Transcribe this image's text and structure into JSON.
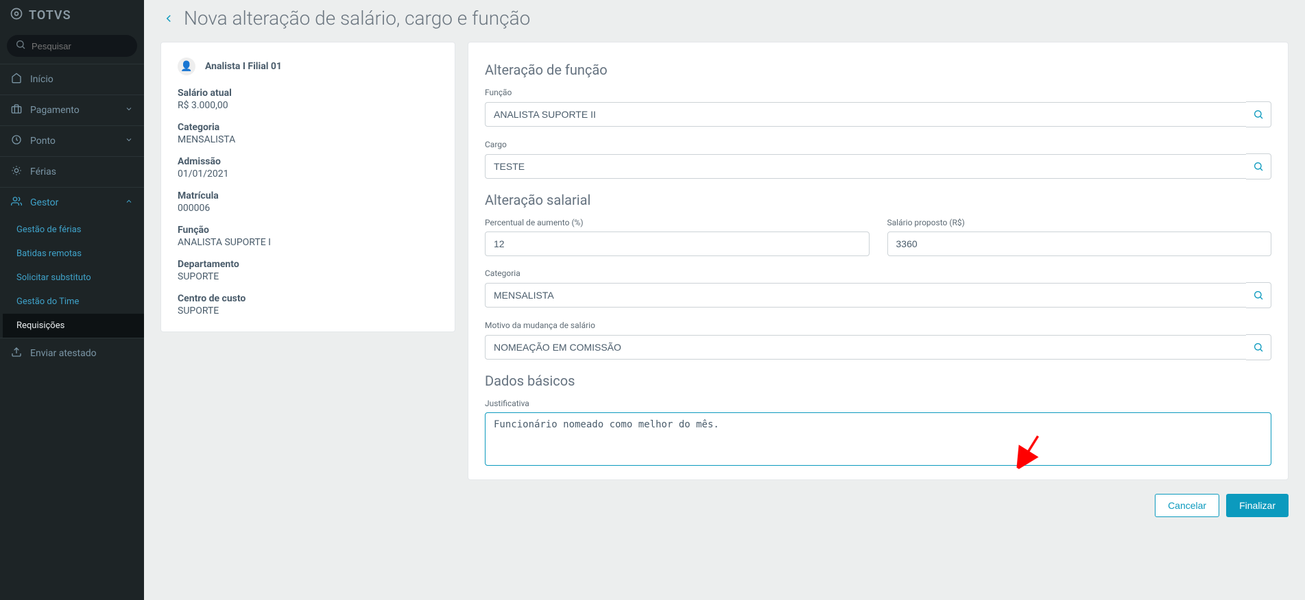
{
  "brand": "TOTVS",
  "search": {
    "placeholder": "Pesquisar"
  },
  "sidebar": {
    "items": [
      {
        "label": "Início"
      },
      {
        "label": "Pagamento"
      },
      {
        "label": "Ponto"
      },
      {
        "label": "Férias"
      },
      {
        "label": "Gestor"
      }
    ],
    "gestor_sub": [
      {
        "label": "Gestão de férias"
      },
      {
        "label": "Batidas remotas"
      },
      {
        "label": "Solicitar substituto"
      },
      {
        "label": "Gestão do Time"
      },
      {
        "label": "Requisições"
      }
    ],
    "enviar_atestado": "Enviar atestado"
  },
  "page": {
    "title": "Nova alteração de salário, cargo e função"
  },
  "employee": {
    "name": "Analista I Filial 01",
    "fields": [
      {
        "k": "Salário atual",
        "v": "R$ 3.000,00"
      },
      {
        "k": "Categoria",
        "v": "MENSALISTA"
      },
      {
        "k": "Admissão",
        "v": "01/01/2021"
      },
      {
        "k": "Matrícula",
        "v": "000006"
      },
      {
        "k": "Função",
        "v": "ANALISTA SUPORTE I"
      },
      {
        "k": "Departamento",
        "v": "SUPORTE"
      },
      {
        "k": "Centro de custo",
        "v": "SUPORTE"
      }
    ]
  },
  "form": {
    "sec_funcao": {
      "title": "Alteração de função",
      "funcao_label": "Função",
      "funcao_value": "ANALISTA SUPORTE II",
      "cargo_label": "Cargo",
      "cargo_value": "TESTE"
    },
    "sec_salarial": {
      "title": "Alteração salarial",
      "percent_label": "Percentual de aumento (%)",
      "percent_value": "12",
      "proposto_label": "Salário proposto (R$)",
      "proposto_value": "3360",
      "categoria_label": "Categoria",
      "categoria_value": "MENSALISTA",
      "motivo_label": "Motivo da mudança de salário",
      "motivo_value": "NOMEAÇÃO EM COMISSÃO"
    },
    "sec_basicos": {
      "title": "Dados básicos",
      "justificativa_label": "Justificativa",
      "justificativa_value": "Funcionário nomeado como melhor do mês."
    }
  },
  "actions": {
    "cancel": "Cancelar",
    "finish": "Finalizar"
  }
}
